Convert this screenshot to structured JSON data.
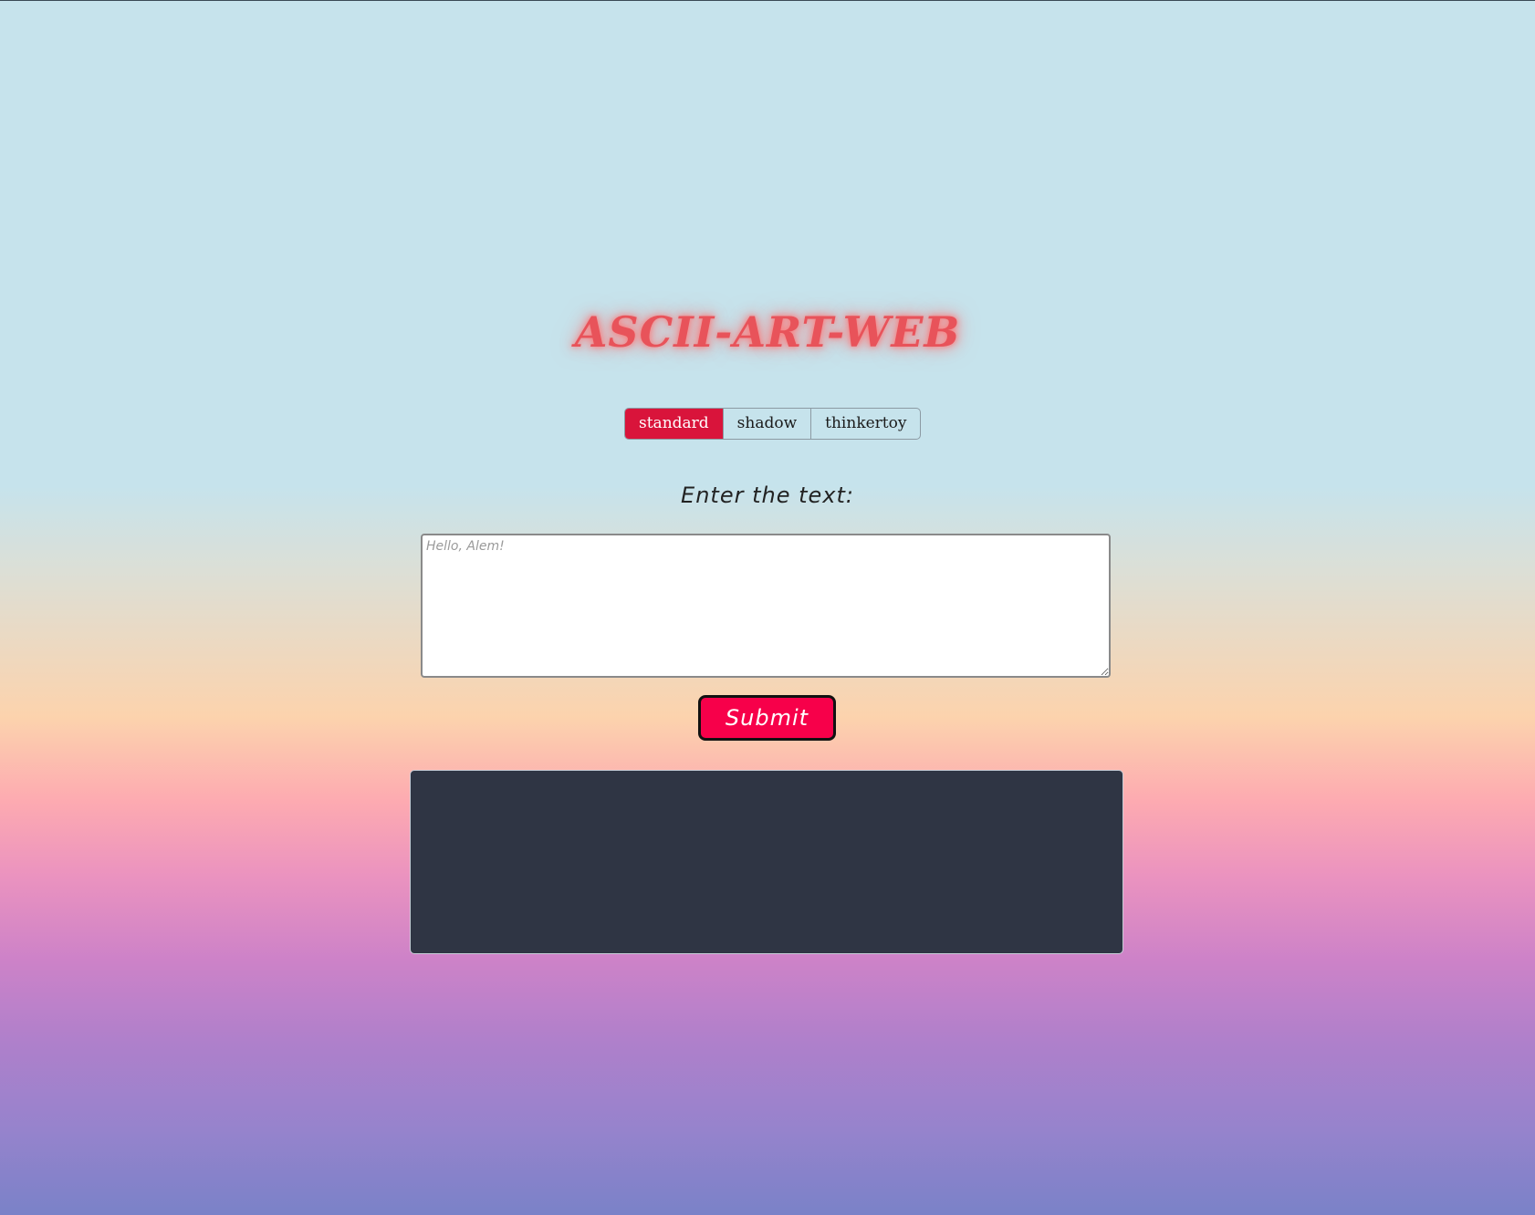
{
  "header": {
    "title": "ASCII-ART-WEB"
  },
  "font_selector": {
    "options": [
      {
        "label": "standard",
        "selected": true
      },
      {
        "label": "shadow",
        "selected": false
      },
      {
        "label": "thinkertoy",
        "selected": false
      }
    ],
    "active_color": "#d9143b"
  },
  "form": {
    "label": "Enter the text:",
    "input_value": "",
    "input_placeholder": "Hello, Alem!",
    "submit_label": "Submit",
    "submit_color": "#f7004a"
  },
  "output": {
    "text": "",
    "background_color": "#2f3544"
  }
}
